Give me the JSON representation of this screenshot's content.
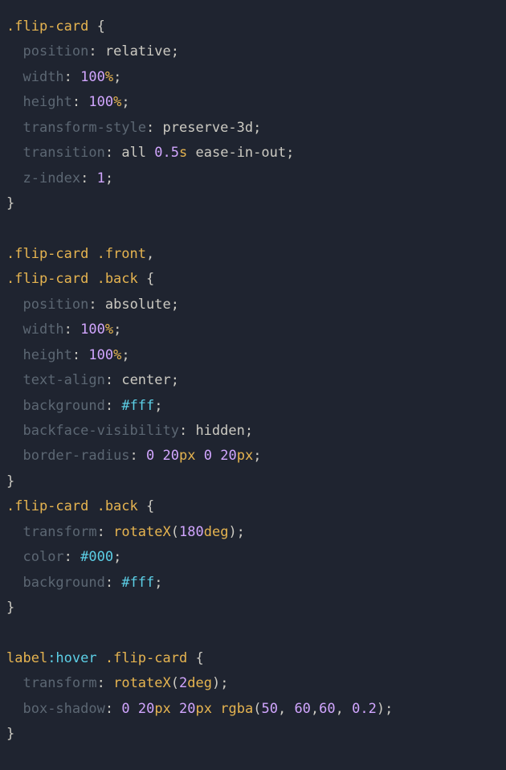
{
  "r1_sel": ".flip-card",
  "r1_p1_k": "position",
  "r1_p1_v": "relative",
  "r1_p2_k": "width",
  "r1_p2_n": "100",
  "r1_p2_u": "%",
  "r1_p3_k": "height",
  "r1_p3_n": "100",
  "r1_p3_u": "%",
  "r1_p4_k": "transform-style",
  "r1_p4_v": "preserve-3d",
  "r1_p5_k": "transition",
  "r1_p5_a": "all",
  "r1_p5_n": "0.5",
  "r1_p5_u": "s",
  "r1_p5_b": "ease-in-out",
  "r1_p6_k": "z-index",
  "r1_p6_n": "1",
  "r2_sel_a": ".flip-card .front",
  "r2_sel_b": ".flip-card .back",
  "r2_p1_k": "position",
  "r2_p1_v": "absolute",
  "r2_p2_k": "width",
  "r2_p2_n": "100",
  "r2_p2_u": "%",
  "r2_p3_k": "height",
  "r2_p3_n": "100",
  "r2_p3_u": "%",
  "r2_p4_k": "text-align",
  "r2_p4_v": "center",
  "r2_p5_k": "background",
  "r2_p5_v": "#fff",
  "r2_p6_k": "backface-visibility",
  "r2_p6_v": "hidden",
  "r2_p7_k": "border-radius",
  "r2_p7_a": "0",
  "r2_p7_b": "20",
  "r2_p7_bu": "px",
  "r2_p7_c": "0",
  "r2_p7_d": "20",
  "r2_p7_du": "px",
  "r3_sel": ".flip-card .back",
  "r3_p1_k": "transform",
  "r3_p1_f": "rotateX",
  "r3_p1_n": "180",
  "r3_p1_u": "deg",
  "r3_p2_k": "color",
  "r3_p2_v": "#000",
  "r3_p3_k": "background",
  "r3_p3_v": "#fff",
  "r4_sel_a": "label",
  "r4_sel_p": ":hover",
  "r4_sel_b": " .flip-card",
  "r4_p1_k": "transform",
  "r4_p1_f": "rotateX",
  "r4_p1_n": "2",
  "r4_p1_u": "deg",
  "r4_p2_k": "box-shadow",
  "r4_p2_a": "0",
  "r4_p2_b": "20",
  "r4_p2_bu": "px",
  "r4_p2_c": "20",
  "r4_p2_cu": "px",
  "r4_p2_fn": "rgba",
  "r4_p2_r": "50",
  "r4_p2_g": "60",
  "r4_p2_bl": "60",
  "r4_p2_al": "0.2"
}
